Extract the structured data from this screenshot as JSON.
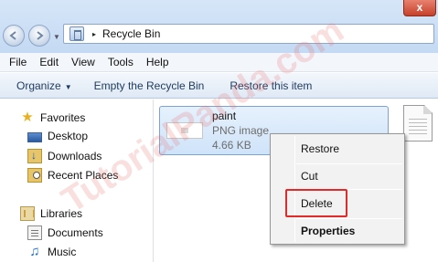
{
  "window": {
    "close_glyph": "x"
  },
  "address_bar": {
    "path_arrow": "▸",
    "location": "Recycle Bin"
  },
  "menu": {
    "items": [
      "File",
      "Edit",
      "View",
      "Tools",
      "Help"
    ]
  },
  "toolbar": {
    "organize": "Organize",
    "organize_caret": "▼",
    "empty_bin": "Empty the Recycle Bin",
    "restore_item": "Restore this item"
  },
  "nav": {
    "favorites": "Favorites",
    "desktop": "Desktop",
    "downloads": "Downloads",
    "recent_places": "Recent Places",
    "libraries": "Libraries",
    "documents": "Documents",
    "music": "Music",
    "star_glyph": "★",
    "note_glyph": "♫"
  },
  "file": {
    "name": "paint",
    "type": "PNG image",
    "size": "4.66 KB"
  },
  "context_menu": {
    "restore": "Restore",
    "cut": "Cut",
    "delete": "Delete",
    "properties": "Properties"
  },
  "watermark": "TutorialPanda.com",
  "colors": {
    "highlight_border": "#e22a2a",
    "selection_fill": "#cfe3f9",
    "toolbar_text": "#1e3a5f"
  }
}
